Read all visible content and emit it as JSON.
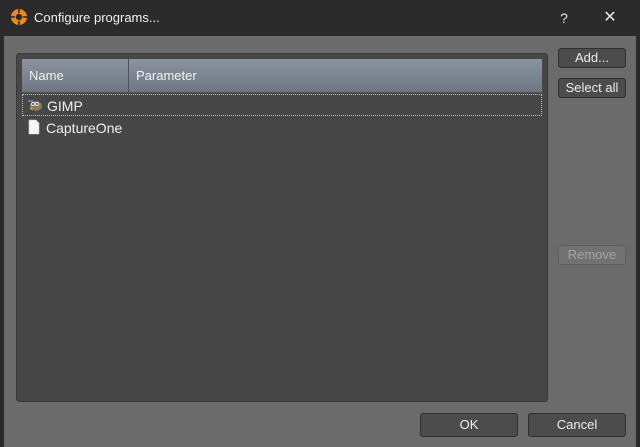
{
  "window": {
    "title": "Configure programs...",
    "help_label": "?",
    "close_label": "✕"
  },
  "list": {
    "columns": [
      "Name",
      "Parameter"
    ],
    "rows": [
      {
        "name": "GIMP",
        "parameter": "",
        "icon": "gimp-icon",
        "selected": true
      },
      {
        "name": "CaptureOne",
        "parameter": "",
        "icon": "document-icon",
        "selected": false
      }
    ]
  },
  "buttons": {
    "add": "Add...",
    "select_all": "Select all",
    "remove": "Remove",
    "ok": "OK",
    "cancel": "Cancel"
  }
}
